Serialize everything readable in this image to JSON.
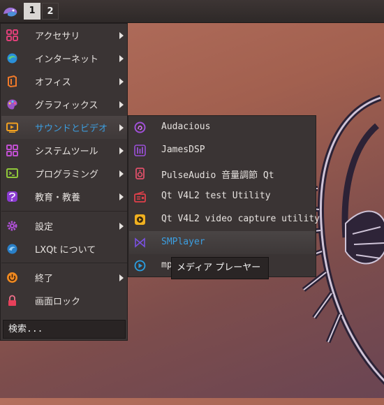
{
  "panel": {
    "start_icon": "lxqt-logo-icon",
    "workspaces": [
      "1",
      "2"
    ],
    "active_workspace": "1"
  },
  "menu": {
    "items": [
      {
        "label": "アクセサリ",
        "icon": "accessories-icon",
        "submenu": true
      },
      {
        "label": "インターネット",
        "icon": "internet-icon",
        "submenu": true
      },
      {
        "label": "オフィス",
        "icon": "office-icon",
        "submenu": true
      },
      {
        "label": "グラフィックス",
        "icon": "graphics-icon",
        "submenu": true
      },
      {
        "label": "サウンドとビデオ",
        "icon": "multimedia-icon",
        "submenu": true,
        "highlighted": true
      },
      {
        "label": "システムツール",
        "icon": "system-tools-icon",
        "submenu": true
      },
      {
        "label": "プログラミング",
        "icon": "programming-icon",
        "submenu": true
      },
      {
        "label": "教育・教養",
        "icon": "education-icon",
        "submenu": true
      },
      {
        "label": "設定",
        "icon": "settings-icon",
        "submenu": true
      },
      {
        "label": "LXQt について",
        "icon": "about-icon",
        "submenu": false
      },
      {
        "label": "終了",
        "icon": "power-icon",
        "submenu": true
      },
      {
        "label": "画面ロック",
        "icon": "lock-icon",
        "submenu": false
      }
    ],
    "search_text": "検索..."
  },
  "submenu": {
    "items": [
      {
        "label": "Audacious",
        "icon": "audacious-icon"
      },
      {
        "label": "JamesDSP",
        "icon": "equalizer-icon"
      },
      {
        "label": "PulseAudio 音量調節 Qt",
        "icon": "speaker-icon"
      },
      {
        "label": "Qt V4L2 test Utility",
        "icon": "radio-icon"
      },
      {
        "label": "Qt V4L2 video capture utility",
        "icon": "video-capture-icon"
      },
      {
        "label": "SMPlayer",
        "icon": "smplayer-icon",
        "highlighted": true
      },
      {
        "label": "mp",
        "icon": "mpv-icon"
      }
    ]
  },
  "tooltip": {
    "text": "メディア プレーヤー"
  },
  "colors": {
    "accent": "#3c9ee0",
    "menu_bg": "#3a3434"
  }
}
